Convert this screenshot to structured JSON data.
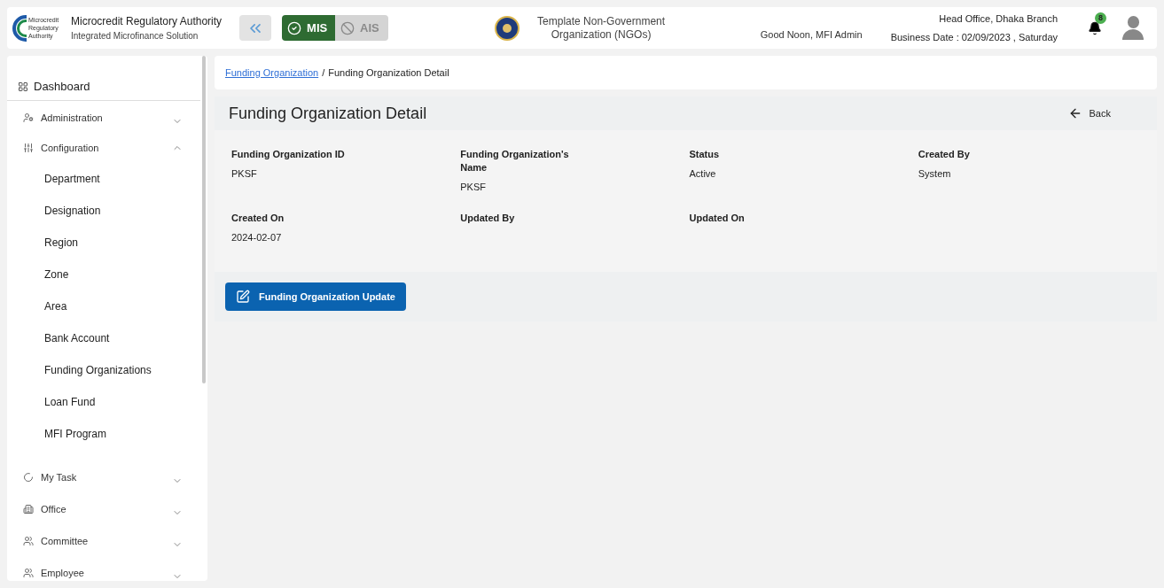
{
  "header": {
    "logo_text": [
      "Microcredit",
      "Regulatory",
      "Authority"
    ],
    "title": "Microcredit Regulatory Authority",
    "subtitle": "Integrated Microfinance Solution",
    "modules": [
      {
        "label": "MIS",
        "selected": true
      },
      {
        "label": "AIS",
        "selected": false
      }
    ],
    "organization": "Template Non-Government Organization (NGOs)",
    "greeting": "Good Noon, MFI Admin",
    "branch": "Head Office, Dhaka Branch",
    "business_date": "Business Date : 02/09/2023 , Saturday",
    "notification_count": "8"
  },
  "sidebar": {
    "dashboard": "Dashboard",
    "items": [
      {
        "label": "Administration",
        "expanded": false
      },
      {
        "label": "Configuration",
        "expanded": true,
        "children": [
          "Department",
          "Designation",
          "Region",
          "Zone",
          "Area",
          "Bank Account",
          "Funding Organizations",
          "Loan Fund",
          "MFI Program"
        ]
      },
      {
        "label": "My Task",
        "expanded": false
      },
      {
        "label": "Office",
        "expanded": false
      },
      {
        "label": "Committee",
        "expanded": false
      },
      {
        "label": "Employee",
        "expanded": false
      }
    ]
  },
  "breadcrumb": {
    "link": "Funding Organization",
    "separator": "/",
    "current": "Funding Organization Detail"
  },
  "page": {
    "title": "Funding Organization Detail",
    "back": "Back",
    "fields": [
      {
        "label": "Funding Organization ID",
        "value": "PKSF"
      },
      {
        "label": "Funding Organization's Name",
        "value": "PKSF"
      },
      {
        "label": "Status",
        "value": "Active"
      },
      {
        "label": "Created By",
        "value": "System"
      },
      {
        "label": "Created On",
        "value": "2024-02-07"
      },
      {
        "label": "Updated By"
      },
      {
        "label": "Updated On"
      }
    ],
    "update_button": "Funding Organization Update"
  }
}
